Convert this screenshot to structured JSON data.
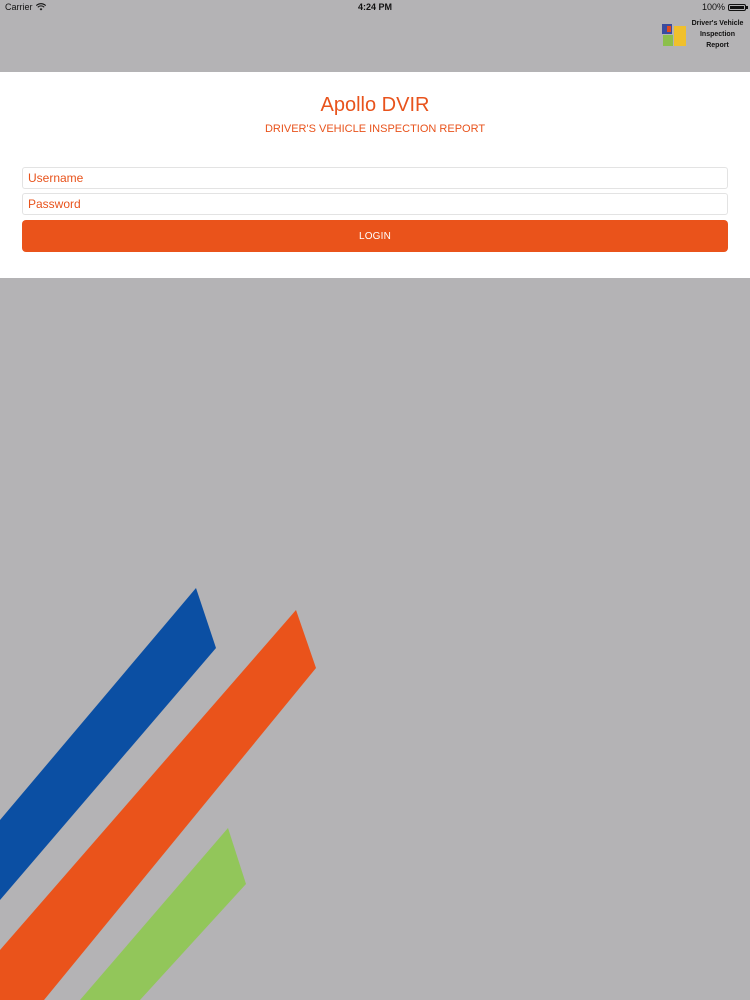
{
  "status_bar": {
    "carrier": "Carrier",
    "time": "4:24 PM",
    "battery": "100%"
  },
  "brand": {
    "line1": "Driver's Vehicle",
    "line2": "Inspection Report"
  },
  "login": {
    "title": "Apollo DVIR",
    "subtitle": "DRIVER'S VEHICLE INSPECTION REPORT",
    "username_placeholder": "Username",
    "password_placeholder": "Password",
    "button_label": "LOGIN"
  },
  "colors": {
    "accent": "#ea531b",
    "background": "#b4b3b5",
    "stripe_blue": "#0b4fa3",
    "stripe_orange": "#ea531b",
    "stripe_green": "#92c65a"
  }
}
